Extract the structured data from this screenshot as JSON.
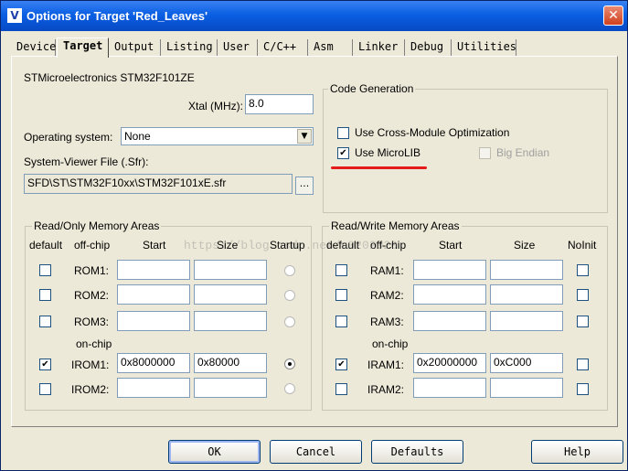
{
  "window": {
    "title": "Options for Target 'Red_Leaves'",
    "close_glyph": "✕",
    "icon_glyph": "V"
  },
  "tabs": [
    {
      "label": "Device"
    },
    {
      "label": "Target",
      "active": true
    },
    {
      "label": "Output"
    },
    {
      "label": "Listing"
    },
    {
      "label": "User"
    },
    {
      "label": "C/C++"
    },
    {
      "label": "Asm"
    },
    {
      "label": "Linker"
    },
    {
      "label": "Debug"
    },
    {
      "label": "Utilities"
    }
  ],
  "target": {
    "device_name": "STMicroelectronics STM32F101ZE",
    "xtal_label": "Xtal (MHz):",
    "xtal_value": "8.0",
    "os_label": "Operating system:",
    "os_value": "None",
    "svf_label": "System-Viewer File (.Sfr):",
    "svf_value": "SFD\\ST\\STM32F10xx\\STM32F101xE.sfr",
    "browse_label": "..."
  },
  "code_generation": {
    "legend": "Code Generation",
    "cross_module_label": "Use Cross-Module Optimization",
    "cross_module_checked": false,
    "microlib_label": "Use MicroLIB",
    "microlib_checked": true,
    "big_endian_label": "Big Endian",
    "big_endian_checked": false,
    "highlight_color": "#e51a1a"
  },
  "ro_memory": {
    "legend": "Read/Only Memory Areas",
    "headers": {
      "default": "default",
      "offchip": "off-chip",
      "start": "Start",
      "size": "Size",
      "startup": "Startup"
    },
    "onchip_label": "on-chip",
    "rows": [
      {
        "label": "ROM1:",
        "start": "",
        "size": "",
        "default": false,
        "startup": false
      },
      {
        "label": "ROM2:",
        "start": "",
        "size": "",
        "default": false,
        "startup": false
      },
      {
        "label": "ROM3:",
        "start": "",
        "size": "",
        "default": false,
        "startup": false
      },
      {
        "label": "IROM1:",
        "start": "0x8000000",
        "size": "0x80000",
        "default": true,
        "startup": true
      },
      {
        "label": "IROM2:",
        "start": "",
        "size": "",
        "default": false,
        "startup": false
      }
    ]
  },
  "rw_memory": {
    "legend": "Read/Write Memory Areas",
    "headers": {
      "default": "default",
      "offchip": "off-chip",
      "start": "Start",
      "size": "Size",
      "noinit": "NoInit"
    },
    "onchip_label": "on-chip",
    "rows": [
      {
        "label": "RAM1:",
        "start": "",
        "size": "",
        "default": false,
        "noinit": false
      },
      {
        "label": "RAM2:",
        "start": "",
        "size": "",
        "default": false,
        "noinit": false
      },
      {
        "label": "RAM3:",
        "start": "",
        "size": "",
        "default": false,
        "noinit": false
      },
      {
        "label": "IRAM1:",
        "start": "0x20000000",
        "size": "0xC000",
        "default": true,
        "noinit": false
      },
      {
        "label": "IRAM2:",
        "start": "",
        "size": "",
        "default": false,
        "noinit": false
      }
    ]
  },
  "buttons": {
    "ok": "OK",
    "cancel": "Cancel",
    "defaults": "Defaults",
    "help": "Help"
  },
  "watermark": "https://blog.csdn.net/u0202020"
}
